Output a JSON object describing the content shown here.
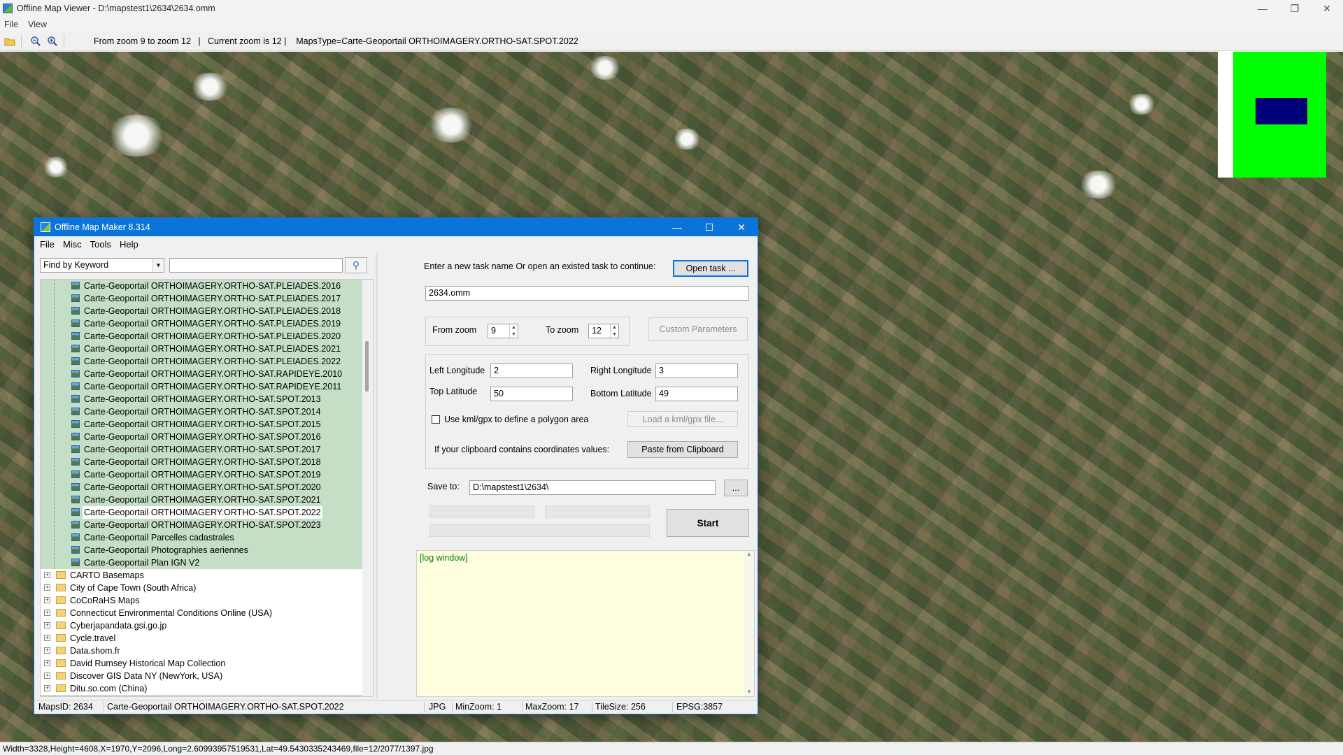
{
  "viewer": {
    "title": "Offline Map Viewer - D:\\mapstest1\\2634\\2634.omm",
    "menu": [
      "File",
      "View"
    ],
    "toolbar_info": "From zoom 9 to zoom 12   |   Current zoom is 12 |    MapsType=Carte-Geoportail ORTHOIMAGERY.ORTHO-SAT.SPOT.2022",
    "status": "Width=3328,Height=4608,X=1970,Y=2096,Long=2.60993957519531,Lat=49.5430335243469,file=12/2077/1397.jpg",
    "icons": [
      "open-folder-icon",
      "zoom-out-icon",
      "zoom-in-icon"
    ],
    "minimap_colors": {
      "background": "#00ff00",
      "viewport": "#00007a"
    }
  },
  "dialog": {
    "title": "Offline Map Maker 8.314",
    "menu": [
      "File",
      "Misc",
      "Tools",
      "Help"
    ],
    "search": {
      "mode": "Find by Keyword",
      "keyword": ""
    },
    "tree": {
      "leaves": [
        "Carte-Geoportail ORTHOIMAGERY.ORTHO-SAT.PLEIADES.2016",
        "Carte-Geoportail ORTHOIMAGERY.ORTHO-SAT.PLEIADES.2017",
        "Carte-Geoportail ORTHOIMAGERY.ORTHO-SAT.PLEIADES.2018",
        "Carte-Geoportail ORTHOIMAGERY.ORTHO-SAT.PLEIADES.2019",
        "Carte-Geoportail ORTHOIMAGERY.ORTHO-SAT.PLEIADES.2020",
        "Carte-Geoportail ORTHOIMAGERY.ORTHO-SAT.PLEIADES.2021",
        "Carte-Geoportail ORTHOIMAGERY.ORTHO-SAT.PLEIADES.2022",
        "Carte-Geoportail ORTHOIMAGERY.ORTHO-SAT.RAPIDEYE.2010",
        "Carte-Geoportail ORTHOIMAGERY.ORTHO-SAT.RAPIDEYE.2011",
        "Carte-Geoportail ORTHOIMAGERY.ORTHO-SAT.SPOT.2013",
        "Carte-Geoportail ORTHOIMAGERY.ORTHO-SAT.SPOT.2014",
        "Carte-Geoportail ORTHOIMAGERY.ORTHO-SAT.SPOT.2015",
        "Carte-Geoportail ORTHOIMAGERY.ORTHO-SAT.SPOT.2016",
        "Carte-Geoportail ORTHOIMAGERY.ORTHO-SAT.SPOT.2017",
        "Carte-Geoportail ORTHOIMAGERY.ORTHO-SAT.SPOT.2018",
        "Carte-Geoportail ORTHOIMAGERY.ORTHO-SAT.SPOT.2019",
        "Carte-Geoportail ORTHOIMAGERY.ORTHO-SAT.SPOT.2020",
        "Carte-Geoportail ORTHOIMAGERY.ORTHO-SAT.SPOT.2021",
        "Carte-Geoportail ORTHOIMAGERY.ORTHO-SAT.SPOT.2022",
        "Carte-Geoportail ORTHOIMAGERY.ORTHO-SAT.SPOT.2023",
        "Carte-Geoportail Parcelles cadastrales",
        "Carte-Geoportail Photographies aeriennes",
        "Carte-Geoportail Plan IGN V2"
      ],
      "selected_leaf": "Carte-Geoportail ORTHOIMAGERY.ORTHO-SAT.SPOT.2022",
      "folders": [
        "CARTO Basemaps",
        "City of Cape Town (South Africa)",
        "CoCoRaHS Maps",
        "Connecticut Environmental Conditions Online (USA)",
        "Cyberjapandata.gsi.go.jp",
        "Cycle.travel",
        "Data.shom.fr",
        "David Rumsey Historical Map Collection",
        "Discover GIS Data NY (NewYork, USA)",
        "Ditu.so.com (China)"
      ]
    },
    "task_prompt": "Enter a new task name Or open an existed task to continue:",
    "open_task_label": "Open task ...",
    "task_name": "2634.omm",
    "from_zoom_label": "From zoom",
    "from_zoom": "9",
    "to_zoom_label": "To zoom",
    "to_zoom": "12",
    "custom_params_label": "Custom Parameters",
    "left_lon_label": "Left Longitude",
    "left_lon": "2",
    "right_lon_label": "Right Longitude",
    "right_lon": "3",
    "top_lat_label": "Top Latitude",
    "top_lat": "50",
    "bottom_lat_label": "Bottom Latitude",
    "bottom_lat": "49",
    "kml_checkbox_label": "Use kml/gpx to define a polygon area",
    "kml_checked": false,
    "load_kml_label": "Load a kml/gpx file...",
    "clipboard_prompt": "If your clipboard contains coordinates values:",
    "paste_label": "Paste from Clipboard",
    "save_to_label": "Save to:",
    "save_to": "D:\\mapstest1\\2634\\",
    "browse_label": "...",
    "start_label": "Start",
    "log_text": "[log window]",
    "status": {
      "maps_id": "MapsID: 2634",
      "map_name": "Carte-Geoportail ORTHOIMAGERY.ORTHO-SAT.SPOT.2022",
      "format": "JPG",
      "min_zoom": "MinZoom: 1",
      "max_zoom": "MaxZoom: 17",
      "tile_size": "TileSize: 256",
      "epsg": "EPSG:3857"
    }
  }
}
